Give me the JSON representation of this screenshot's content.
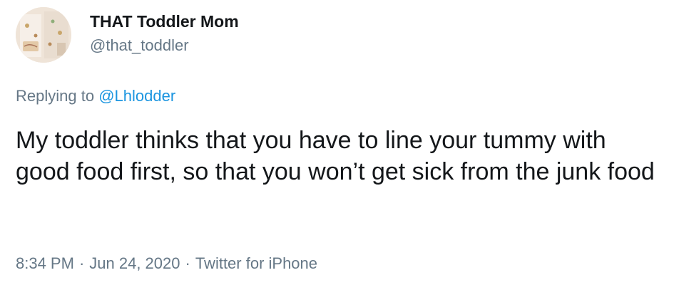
{
  "author": {
    "display_name": "THAT Toddler Mom",
    "handle": "@that_toddler",
    "avatar_icon": "profile-photo-avatar"
  },
  "reply": {
    "prefix": "Replying to",
    "mention": "@Lhlodder"
  },
  "tweet": {
    "text": "My toddler thinks that you have to line your tummy with good food first, so that you won’t get sick from the junk food"
  },
  "meta": {
    "time": "8:34 PM",
    "separator": "·",
    "date": "Jun 24, 2020",
    "source": "Twitter for iPhone"
  },
  "colors": {
    "text": "#14171a",
    "secondary": "#657786",
    "link": "#1b95e0"
  }
}
